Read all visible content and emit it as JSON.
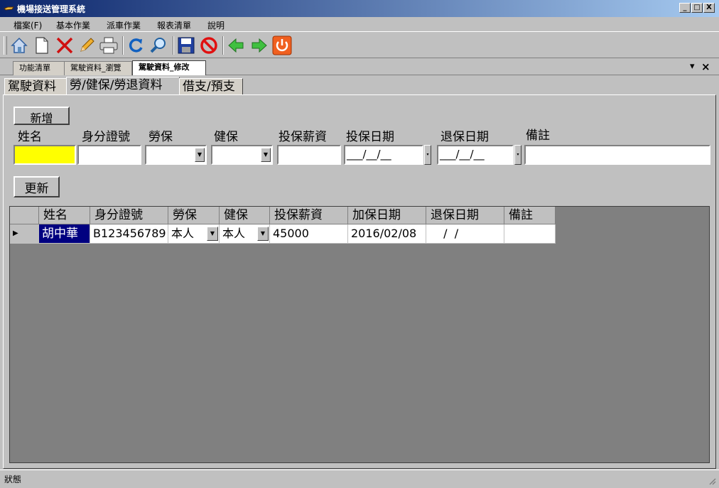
{
  "window": {
    "title": "機場接送管理系統",
    "min": "_",
    "max": "□",
    "close": "X"
  },
  "menu": [
    "檔案(F)",
    "基本作業",
    "派車作業",
    "報表清單",
    "說明"
  ],
  "toolbar": [
    "home-icon",
    "new-document-icon",
    "delete-icon",
    "edit-pencil-icon",
    "print-icon",
    "refresh-icon",
    "search-icon",
    "save-icon",
    "cancel-icon",
    "back-arrow-icon",
    "forward-arrow-icon",
    "power-icon"
  ],
  "doc_tabs": [
    "功能清單",
    "駕駛資料_瀏覽",
    "駕駛資料_修改"
  ],
  "doc_tab_controls": {
    "dropdown": "▾",
    "close": "×"
  },
  "inner_tabs": [
    "駕駛資料",
    "勞/健保/勞退資料",
    "借支/預支"
  ],
  "form": {
    "add_button": "新增",
    "update_button": "更新",
    "labels": {
      "name": "姓名",
      "id_no": "身分證號",
      "labor": "勞保",
      "health": "健保",
      "salary": "投保薪資",
      "start_date": "投保日期",
      "end_date": "退保日期",
      "note": "備註"
    },
    "date_placeholder": "___/__/__",
    "name_value": "",
    "id_value": "",
    "salary_value": "",
    "note_value": ""
  },
  "grid": {
    "headers": [
      "姓名",
      "身分證號",
      "勞保",
      "健保",
      "投保薪資",
      "加保日期",
      "退保日期",
      "備註"
    ],
    "rows": [
      {
        "name": "胡中華",
        "id_no": "B123456789",
        "labor": "本人",
        "health": "本人",
        "salary": "45000",
        "start_date": "2016/02/08",
        "end_date": "  /  /",
        "note": ""
      }
    ]
  },
  "status": {
    "text": "狀態"
  },
  "colors": {
    "title_start": "#0a246a",
    "title_end": "#a6caf0",
    "highlight_input": "#ffff00",
    "selected_cell": "#000080",
    "grid_bg": "#808080"
  }
}
